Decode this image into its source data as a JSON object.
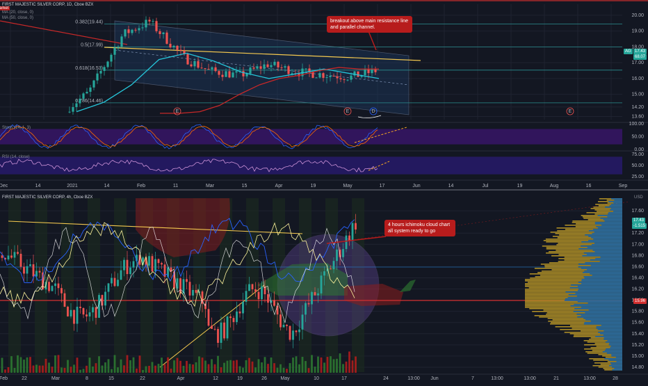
{
  "colors": {
    "bg": "#131722",
    "grid": "#1f2330",
    "up": "#26a69a",
    "down": "#ef5350",
    "channel": "#1e3a5f",
    "fib": "#2a8f8f",
    "resistance": "#f5c94f",
    "ma_teal": "#26c6da",
    "ma_red": "#c62828",
    "stoch_band": "#4a148c",
    "rsi_band": "#311b92",
    "callout": "#b71c1c",
    "support": "#d32f2f",
    "volume_profile": "#c9a227",
    "volume_profile_blue": "#1e6fb8",
    "ichimoku_green": "#2e7d32",
    "ichimoku_red": "#8b1d1d",
    "circle": "#7e57c2"
  },
  "top_panel": {
    "symbol": "FIRST MAJESTIC SILVER CORP, 1D, Cboe BZX",
    "indicator_1": "MA (20, close, 0)",
    "indicator_2": "MA (50, close, 0)",
    "partial_label": "arket",
    "fib_levels": [
      {
        "label": "0.382(19.44)",
        "price": 19.44
      },
      {
        "label": "0.5(17.99)",
        "price": 17.99
      },
      {
        "label": "0.618(16.53)",
        "price": 16.53
      },
      {
        "label": "0.786(14.46)",
        "price": 14.46
      }
    ],
    "price_axis": [
      "20.00",
      "19.00",
      "18.00",
      "17.00",
      "16.00",
      "15.00",
      "14.20",
      "13.60"
    ],
    "current_price": "17.43",
    "current_price_2": "68.07",
    "ticker_badge": "AG",
    "callout": "breakout above main resistance line and parallel channel.",
    "earnings_marks": [
      "E",
      "E",
      "D",
      "E"
    ]
  },
  "stoch_panel": {
    "label": "Stoch (14, 1, 3)",
    "axis": [
      "100.00",
      "50.00",
      "0.00"
    ]
  },
  "rsi_panel": {
    "label": "RSI (14, close)",
    "axis": [
      "75.00",
      "50.00",
      "25.00"
    ]
  },
  "top_time_axis": [
    "Dec",
    "14",
    "2021",
    "14",
    "Feb",
    "11",
    "Mar",
    "15",
    "Apr",
    "19",
    "May",
    "17",
    "Jun",
    "14",
    "Jul",
    "19",
    "Aug",
    "16",
    "Sep"
  ],
  "bottom_panel": {
    "symbol": "FIRST MAJESTIC SILVER CORP, 4h, Cboe BZX",
    "currency": "USD",
    "price_axis": [
      "17.60",
      "17.20",
      "17.00",
      "16.80",
      "16.60",
      "16.40",
      "16.20",
      "16.00",
      "15.80",
      "15.60",
      "15.40",
      "15.20",
      "15.00",
      "14.80"
    ],
    "current_price": "17.43",
    "change": "-1.515",
    "support_price": "15.96",
    "callout": "4 hours ichimoku cloud chart all system ready to go",
    "profile_axis": [
      "13:00",
      "21",
      "13:00",
      "28"
    ]
  },
  "bottom_time_axis": [
    "Feb",
    "22",
    "Mar",
    "8",
    "15",
    "22",
    "Apr",
    "12",
    "19",
    "26",
    "May",
    "10",
    "17",
    "24",
    "13:00",
    "Jun",
    "7",
    "13:00"
  ],
  "chart_data": {
    "type": "candlestick",
    "title": "FIRST MAJESTIC SILVER CORP, 1D, Cboe BZX",
    "x": [
      "Dec",
      "14",
      "2021",
      "14",
      "Feb",
      "11",
      "Mar",
      "15",
      "Apr",
      "19",
      "May",
      "17"
    ],
    "ylim": [
      13.6,
      20.5
    ],
    "series": [
      {
        "name": "MA (20, close, 0)",
        "values": [
          13.9,
          14.5,
          15.6,
          17.2,
          17.6,
          17.1,
          16.4,
          16.0,
          16.3,
          16.6,
          16.3,
          16.0
        ]
      },
      {
        "name": "MA (50, close, 0)",
        "values": [
          13.8,
          13.8,
          13.9,
          14.3,
          15.0,
          15.6,
          16.0,
          16.2,
          16.5,
          16.7,
          16.6,
          16.6
        ]
      }
    ],
    "close": [
      13.9,
      14.2,
      15.1,
      18.8,
      19.6,
      17.3,
      16.5,
      16.2,
      16.9,
      16.4,
      16.1,
      17.43
    ]
  }
}
